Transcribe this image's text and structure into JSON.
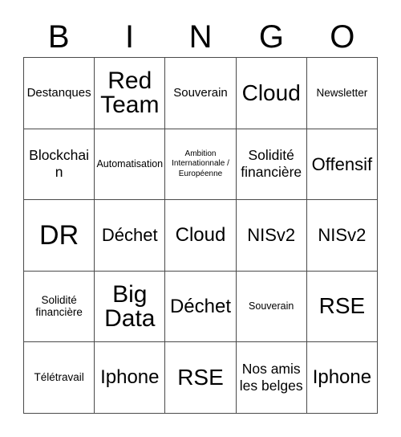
{
  "card": {
    "title_letters": [
      "B",
      "I",
      "N",
      "G",
      "O"
    ],
    "colors": {
      "background": "#ffffff",
      "text": "#000000",
      "grid_line": "#4a4a4a"
    },
    "grid": {
      "rows": 5,
      "columns": 5,
      "cells": [
        [
          {
            "text": "Destanques",
            "size": "fs-m"
          },
          {
            "text": "Red Team",
            "size": "fs-h1"
          },
          {
            "text": "Souverain",
            "size": "fs-m"
          },
          {
            "text": "Cloud",
            "size": "fs-xxl"
          },
          {
            "text": "Newsletter",
            "size": "fs-sm"
          }
        ],
        [
          {
            "text": "Blockchain",
            "size": "fs-ml"
          },
          {
            "text": "Automatisation",
            "size": "fs-s"
          },
          {
            "text": "Ambition Internationnale / Européenne",
            "size": "fs-xs"
          },
          {
            "text": "Solidité financière",
            "size": "fs-ml"
          },
          {
            "text": "Offensif",
            "size": "fs-l"
          }
        ],
        [
          {
            "text": "DR",
            "size": "fs-h2"
          },
          {
            "text": "Déchet",
            "size": "fs-l"
          },
          {
            "text": "Cloud",
            "size": "fs-xl"
          },
          {
            "text": "NISv2",
            "size": "fs-l"
          },
          {
            "text": "NISv2",
            "size": "fs-l"
          }
        ],
        [
          {
            "text": "Solidité financière",
            "size": "fs-sm"
          },
          {
            "text": "Big Data",
            "size": "fs-h1"
          },
          {
            "text": "Déchet",
            "size": "fs-xl"
          },
          {
            "text": "Souverain",
            "size": "fs-s"
          },
          {
            "text": "RSE",
            "size": "fs-xxl"
          }
        ],
        [
          {
            "text": "Télétravail",
            "size": "fs-sm"
          },
          {
            "text": "Iphone",
            "size": "fs-xl"
          },
          {
            "text": "RSE",
            "size": "fs-xxl"
          },
          {
            "text": "Nos amis les belges",
            "size": "fs-ml"
          },
          {
            "text": "Iphone",
            "size": "fs-xl"
          }
        ]
      ]
    }
  }
}
